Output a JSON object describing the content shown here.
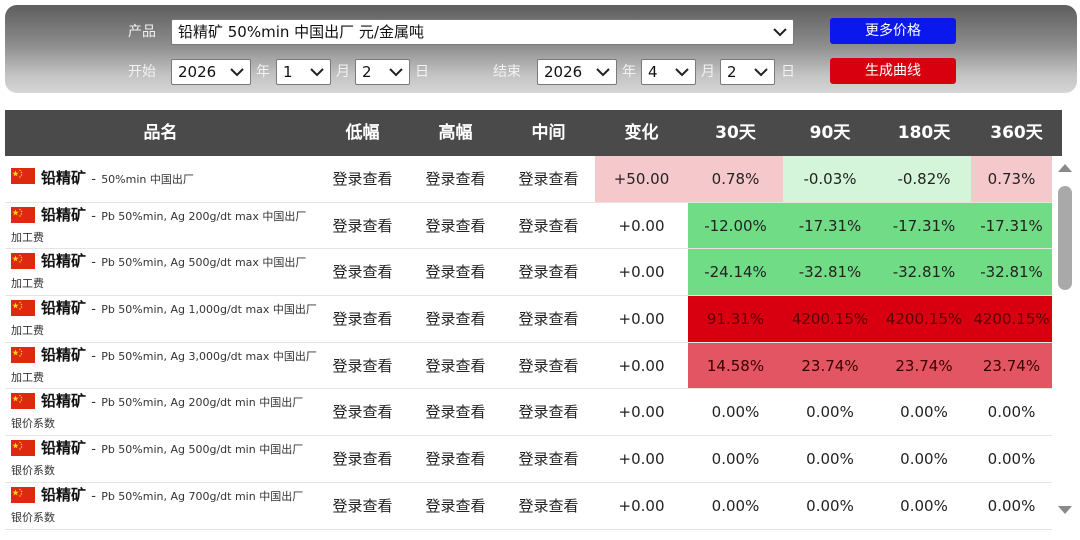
{
  "filters": {
    "product_label": "产品",
    "product_value": "铅精矿 50%min 中国出厂 元/金属吨",
    "start_label": "开始",
    "end_label": "结束",
    "year_unit": "年",
    "month_unit": "月",
    "day_unit": "日",
    "start": {
      "year": "2026",
      "month": "1",
      "day": "2"
    },
    "end": {
      "year": "2026",
      "month": "4",
      "day": "2"
    },
    "more_prices_button": "更多价格",
    "generate_chart_button": "生成曲线"
  },
  "colors": {
    "blue_button": "#0a18ee",
    "red_button": "#d8000e",
    "header_bg": "#4a4a4a",
    "light_red": "#f5c9cc",
    "light_green": "#d4f5d9",
    "green": "#70dc86",
    "dark_red": "#d80010",
    "salmon": "#e45563"
  },
  "table": {
    "headers": [
      "品名",
      "低幅",
      "高幅",
      "中间",
      "变化",
      "30天",
      "90天",
      "180天",
      "360天"
    ],
    "rows": [
      {
        "name": "铅精矿",
        "spec": "50%min 中国出厂",
        "sub": "",
        "low": "登录查看",
        "high": "登录查看",
        "mid": "登录查看",
        "change": "+50.00",
        "d30": "0.78%",
        "d90": "-0.03%",
        "d180": "-0.82%",
        "d360": "0.73%"
      },
      {
        "name": "铅精矿",
        "spec": "Pb 50%min, Ag 200g/dt max 中国出厂",
        "sub": "加工费",
        "low": "登录查看",
        "high": "登录查看",
        "mid": "登录查看",
        "change": "+0.00",
        "d30": "-12.00%",
        "d90": "-17.31%",
        "d180": "-17.31%",
        "d360": "-17.31%"
      },
      {
        "name": "铅精矿",
        "spec": "Pb 50%min, Ag 500g/dt max 中国出厂",
        "sub": "加工费",
        "low": "登录查看",
        "high": "登录查看",
        "mid": "登录查看",
        "change": "+0.00",
        "d30": "-24.14%",
        "d90": "-32.81%",
        "d180": "-32.81%",
        "d360": "-32.81%"
      },
      {
        "name": "铅精矿",
        "spec": "Pb 50%min, Ag 1,000g/dt max 中国出厂",
        "sub": "加工费",
        "low": "登录查看",
        "high": "登录查看",
        "mid": "登录查看",
        "change": "+0.00",
        "d30": "91.31%",
        "d90": "4200.15%",
        "d180": "4200.15%",
        "d360": "4200.15%"
      },
      {
        "name": "铅精矿",
        "spec": "Pb 50%min, Ag 3,000g/dt max 中国出厂",
        "sub": "加工费",
        "low": "登录查看",
        "high": "登录查看",
        "mid": "登录查看",
        "change": "+0.00",
        "d30": "14.58%",
        "d90": "23.74%",
        "d180": "23.74%",
        "d360": "23.74%"
      },
      {
        "name": "铅精矿",
        "spec": "Pb 50%min, Ag 200g/dt min 中国出厂",
        "sub": "银价系数",
        "low": "登录查看",
        "high": "登录查看",
        "mid": "登录查看",
        "change": "+0.00",
        "d30": "0.00%",
        "d90": "0.00%",
        "d180": "0.00%",
        "d360": "0.00%"
      },
      {
        "name": "铅精矿",
        "spec": "Pb 50%min, Ag 500g/dt min 中国出厂",
        "sub": "银价系数",
        "low": "登录查看",
        "high": "登录查看",
        "mid": "登录查看",
        "change": "+0.00",
        "d30": "0.00%",
        "d90": "0.00%",
        "d180": "0.00%",
        "d360": "0.00%"
      },
      {
        "name": "铅精矿",
        "spec": "Pb 50%min, Ag 700g/dt min 中国出厂",
        "sub": "银价系数",
        "low": "登录查看",
        "high": "登录查看",
        "mid": "登录查看",
        "change": "+0.00",
        "d30": "0.00%",
        "d90": "0.00%",
        "d180": "0.00%",
        "d360": "0.00%"
      }
    ]
  }
}
